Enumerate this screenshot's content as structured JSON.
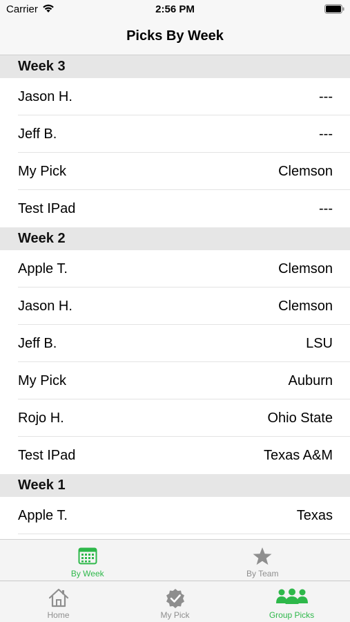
{
  "status_bar": {
    "carrier": "Carrier",
    "time": "2:56 PM"
  },
  "nav": {
    "title": "Picks By Week"
  },
  "sections": [
    {
      "header": "Week 3",
      "rows": [
        {
          "name": "Jason H.",
          "pick": "---"
        },
        {
          "name": "Jeff B.",
          "pick": "---"
        },
        {
          "name": "My Pick",
          "pick": "Clemson"
        },
        {
          "name": "Test IPad",
          "pick": "---"
        }
      ]
    },
    {
      "header": "Week 2",
      "rows": [
        {
          "name": "Apple T.",
          "pick": "Clemson"
        },
        {
          "name": "Jason H.",
          "pick": "Clemson"
        },
        {
          "name": "Jeff B.",
          "pick": "LSU"
        },
        {
          "name": "My Pick",
          "pick": "Auburn"
        },
        {
          "name": "Rojo H.",
          "pick": "Ohio State"
        },
        {
          "name": "Test IPad",
          "pick": "Texas A&M"
        }
      ]
    },
    {
      "header": "Week 1",
      "rows": [
        {
          "name": "Apple T.",
          "pick": "Texas"
        }
      ]
    }
  ],
  "top_tabs": [
    {
      "label": "By Week",
      "icon": "calendar-icon",
      "active": true
    },
    {
      "label": "By Team",
      "icon": "star-icon",
      "active": false
    }
  ],
  "bottom_tabs": [
    {
      "label": "Home",
      "icon": "house-icon",
      "active": false
    },
    {
      "label": "My Pick",
      "icon": "checkmark-seal-icon",
      "active": false
    },
    {
      "label": "Group Picks",
      "icon": "group-icon",
      "active": true
    }
  ],
  "colors": {
    "accent": "#2eb84a",
    "inactive": "#8e8e8e",
    "section_bg": "#e6e6e6"
  }
}
